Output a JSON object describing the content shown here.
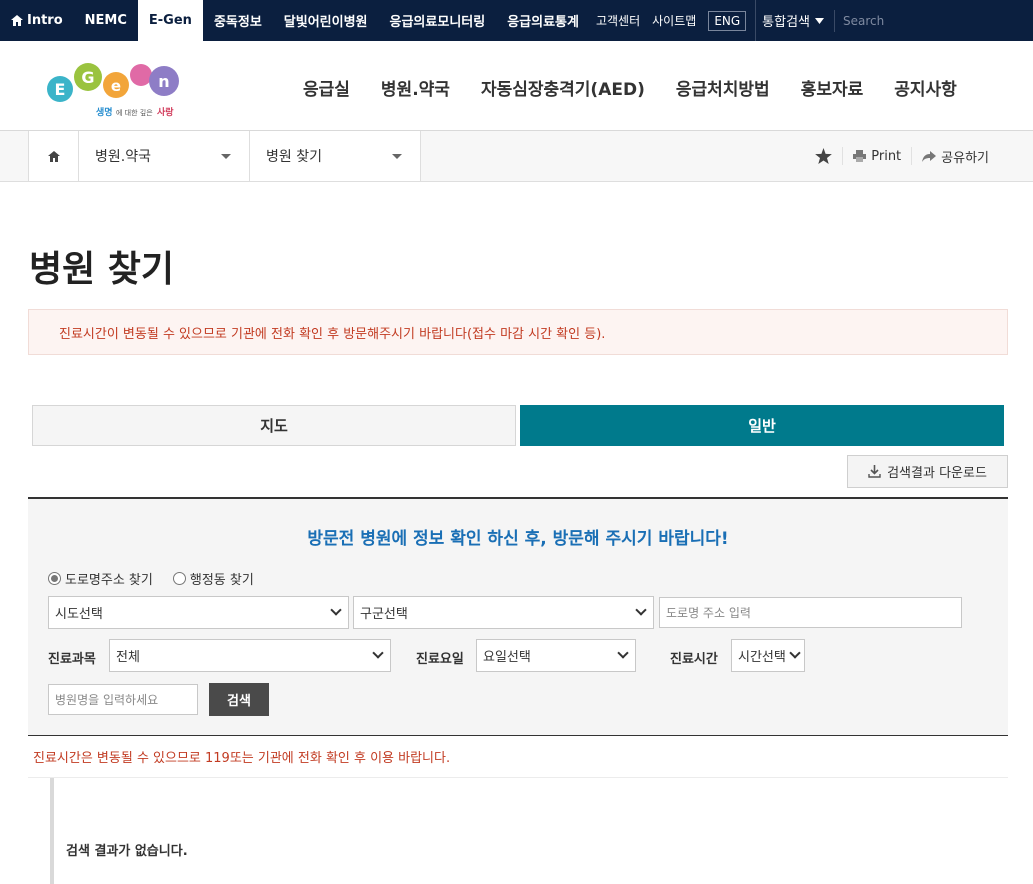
{
  "topbar": {
    "intro": "Intro",
    "nemc": "NEMC",
    "egen": "E-Gen",
    "items": [
      "중독정보",
      "달빛어린이병원",
      "응급의료모니터링",
      "응급의료통계"
    ],
    "customer": "고객센터",
    "sitemap": "사이트맵",
    "eng": "ENG",
    "search_toggle": "통합검색",
    "search_placeholder": "Search"
  },
  "logo": {
    "text": "E-Gen",
    "tagline_a": "생명",
    "tagline_b": "에 대한 깊은 ",
    "tagline_c": "사랑"
  },
  "gnb": [
    "응급실",
    "병원.약국",
    "자동심장충격기(AED)",
    "응급처치방법",
    "홍보자료",
    "공지사항"
  ],
  "breadcrumb": {
    "level1": "병원.약국",
    "level2": "병원 찾기"
  },
  "tools": {
    "print": "Print",
    "share": "공유하기"
  },
  "page": {
    "title": "병원 찾기",
    "notice": "진료시간이 변동될 수 있으므로 기관에 전화 확인 후 방문해주시기 바랍니다(접수 마감 시간 확인 등)."
  },
  "tabs": {
    "map": "지도",
    "general": "일반"
  },
  "download": "검색결과 다운로드",
  "search": {
    "title": "방문전 병원에 정보 확인 하신 후, 방문해 주시기 바랍니다!",
    "radio_road": "도로명주소 찾기",
    "radio_admin": "행정동 찾기",
    "sido": "시도선택",
    "gugun": "구군선택",
    "road_placeholder": "도로명 주소 입력",
    "dept_label": "진료과목",
    "dept_value": "전체",
    "day_label": "진료요일",
    "day_value": "요일선택",
    "time_label": "진료시간",
    "time_value": "시간선택",
    "name_placeholder": "병원명을 입력하세요",
    "button": "검색"
  },
  "notice2": "진료시간은 변동될 수 있으므로 119또는 기관에 전화 확인 후 이용 바랍니다.",
  "result": "검색 결과가 없습니다.",
  "colors": {
    "topbar": "#0b1f3f",
    "accent": "#007a8c",
    "title_blue": "#1a6fb5",
    "notice_red": "#c23b22"
  }
}
